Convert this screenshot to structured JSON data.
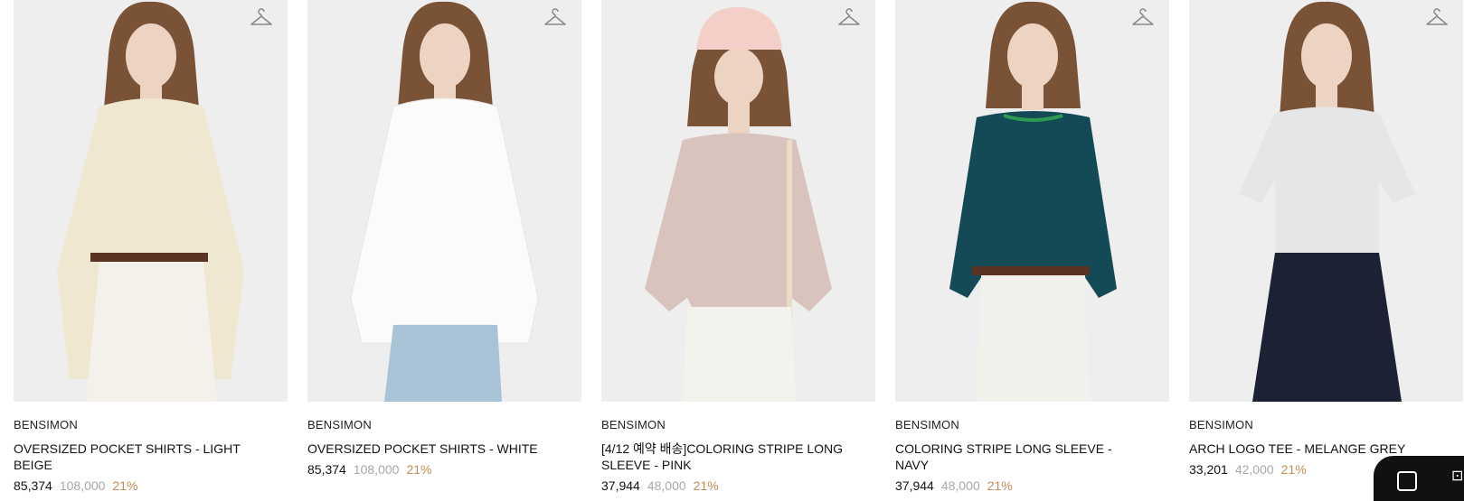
{
  "products": [
    {
      "brand": "BENSIMON",
      "name": "OVERSIZED POCKET SHIRTS - LIGHT BEIGE",
      "sale_price": "85,374",
      "original_price": "108,000",
      "discount": "21%",
      "icon": "hanger-icon",
      "colors": {
        "top": "#efe7cf",
        "bottom": "#f3f1ea",
        "hair": "#7a5236"
      }
    },
    {
      "brand": "BENSIMON",
      "name": "OVERSIZED POCKET SHIRTS - WHITE",
      "sale_price": "85,374",
      "original_price": "108,000",
      "discount": "21%",
      "icon": "hanger-icon",
      "colors": {
        "top": "#fbfbfb",
        "bottom": "#a9c3d6",
        "hair": "#7a5236"
      }
    },
    {
      "brand": "BENSIMON",
      "name": "[4/12 예약 배송]COLORING STRIPE LONG SLEEVE - PINK",
      "sale_price": "37,944",
      "original_price": "48,000",
      "discount": "21%",
      "icon": "hanger-icon",
      "colors": {
        "top": "#d9c3bd",
        "bottom": "#f4f2ec",
        "hair": "#7a5236",
        "cap": "#f3cfc8"
      }
    },
    {
      "brand": "BENSIMON",
      "name": "COLORING STRIPE LONG SLEEVE - NAVY",
      "sale_price": "37,944",
      "original_price": "48,000",
      "discount": "21%",
      "icon": "hanger-icon",
      "colors": {
        "top": "#144a55",
        "bottom": "#f2f0ea",
        "hair": "#7a5236"
      }
    },
    {
      "brand": "BENSIMON",
      "name": "ARCH LOGO TEE - MELANGE GREY",
      "sale_price": "33,201",
      "original_price": "42,000",
      "discount": "21%",
      "icon": "hanger-icon",
      "colors": {
        "top": "#e6e6e8",
        "bottom": "#1c2233",
        "hair": "#7a5236"
      }
    }
  ]
}
